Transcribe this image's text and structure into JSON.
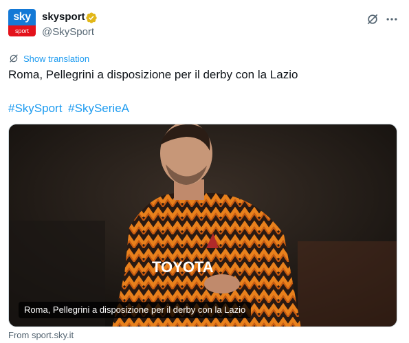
{
  "author": {
    "avatar_top": "sky",
    "avatar_bottom": "sport",
    "display_name": "skysport",
    "handle": "@SkySport",
    "verified_color": "#e2b719"
  },
  "actions": {
    "grok_icon": "grok-icon",
    "more_icon": "more-icon"
  },
  "translation": {
    "label": "Show translation"
  },
  "tweet": {
    "text": "Roma, Pellegrini a disposizione per il derby con la Lazio",
    "hashtags": [
      "#SkySport",
      "#SkySerieA"
    ]
  },
  "media": {
    "caption": "Roma, Pellegrini a disposizione per il derby con la Lazio",
    "shirt_sponsor": "TOYOTA"
  },
  "card_source": "From sport.sky.it",
  "colors": {
    "link": "#1d9bf0",
    "text": "#0f1419",
    "muted": "#536471",
    "sky_blue": "#1479d6",
    "sky_red": "#e3121b"
  }
}
